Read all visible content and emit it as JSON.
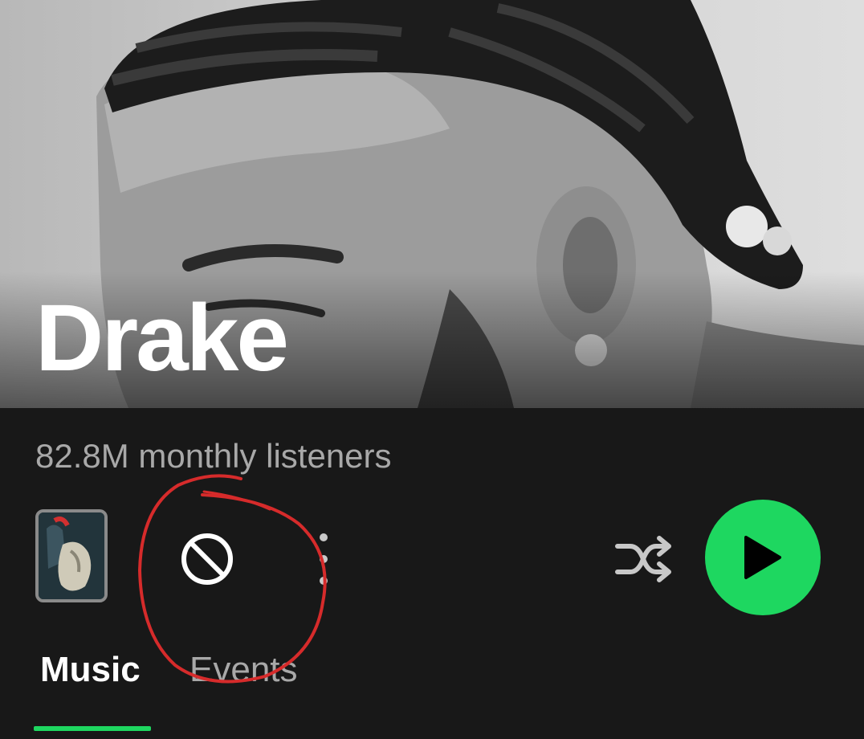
{
  "artist": {
    "name": "Drake",
    "listeners": "82.8M monthly listeners"
  },
  "actions": {
    "cover_icon": "album-cover-icon",
    "block_icon": "block-icon",
    "more_icon": "more-vertical-icon",
    "shuffle_icon": "shuffle-icon",
    "play_icon": "play-icon"
  },
  "tabs": [
    {
      "label": "Music",
      "active": true
    },
    {
      "label": "Events",
      "active": false
    }
  ],
  "colors": {
    "accent": "#1ed760",
    "background": "#181818",
    "annotation": "#d62b2b"
  }
}
